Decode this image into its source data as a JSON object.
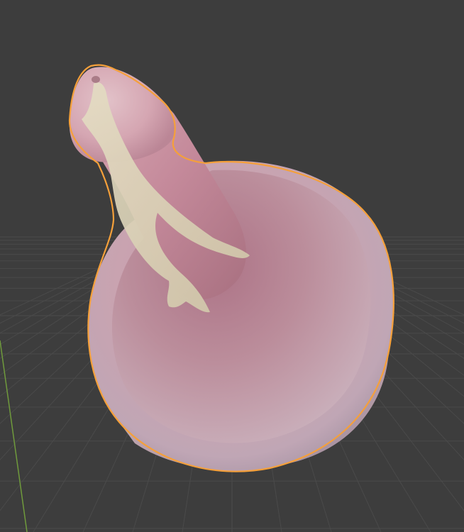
{
  "viewport": {
    "background_color": "#3d3d3d",
    "grid_color": "#4a4a4a",
    "y_axis_color": "#6f9a3c"
  },
  "scene": {
    "selected_object": {
      "selection_outline_color": "#f5a03a",
      "base_color": "#d9b5c0",
      "inner_color": "#b57f8f",
      "rim_color": "#c7aab5",
      "overlay_color": "#ddd3b4"
    }
  }
}
